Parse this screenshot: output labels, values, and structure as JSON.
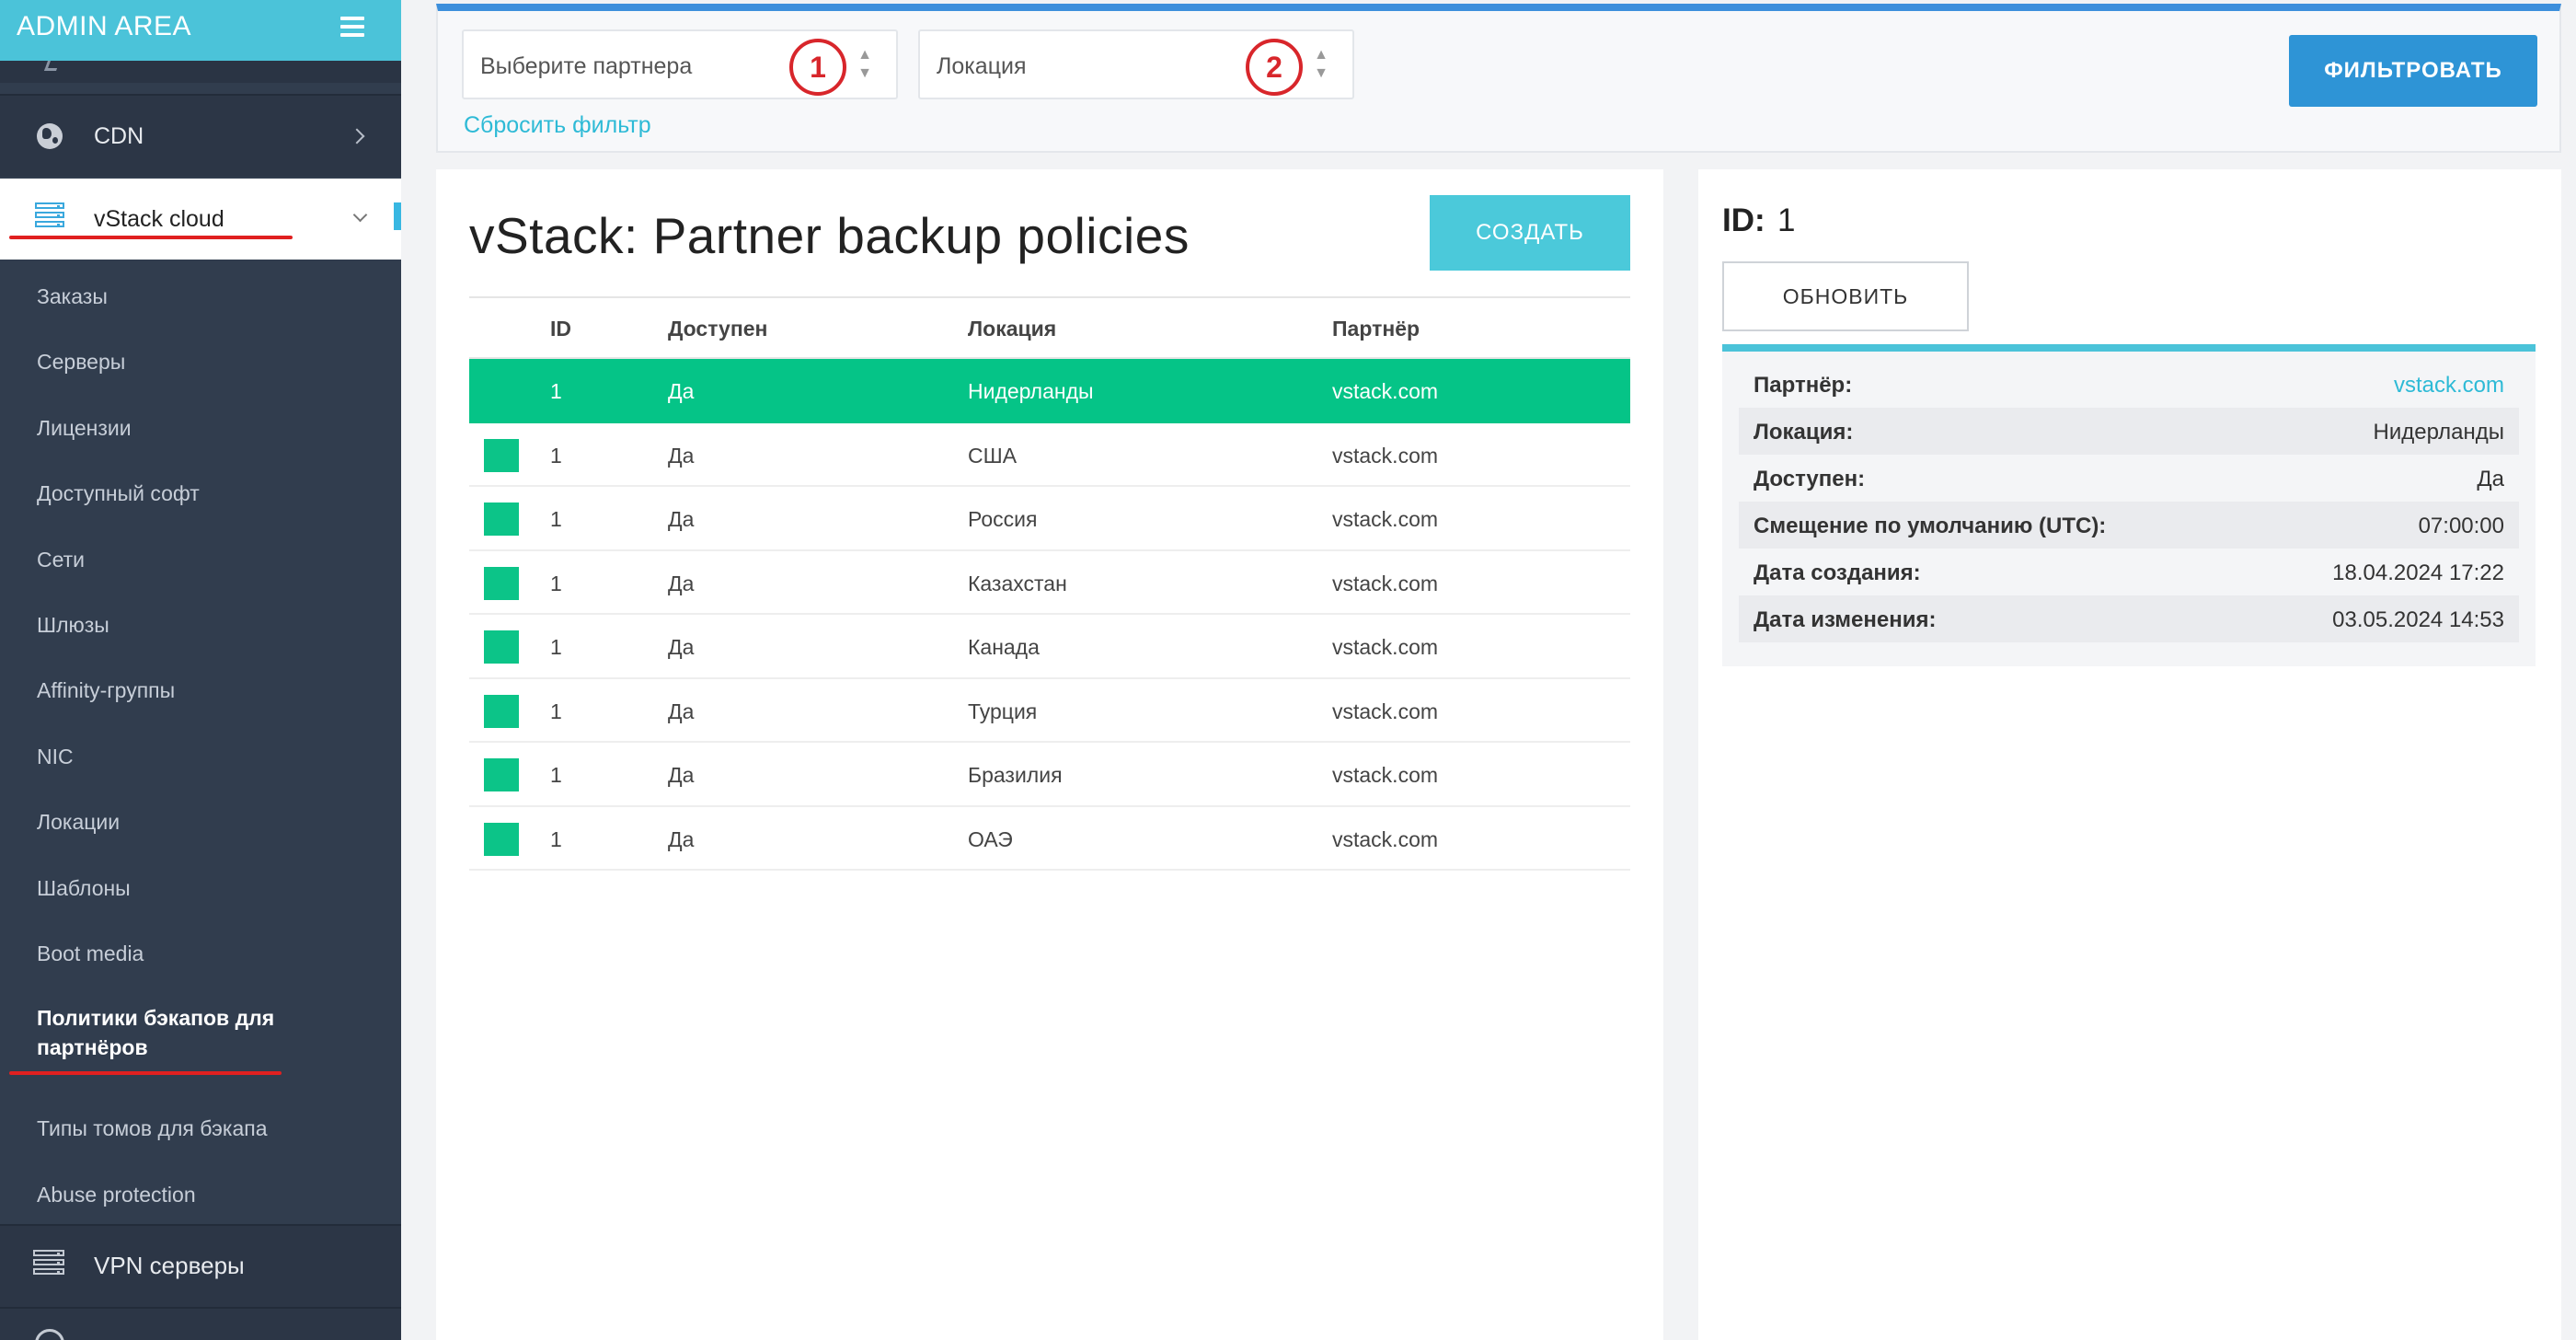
{
  "sidebar": {
    "title": "ADMIN AREA",
    "cdn_label": "CDN",
    "vstack_label": "vStack cloud",
    "menu_items": [
      "Заказы",
      "Серверы",
      "Лицензии",
      "Доступный софт",
      "Сети",
      "Шлюзы",
      "Affinity-группы",
      "NIC",
      "Локации",
      "Шаблоны",
      "Boot media"
    ],
    "active_item_line1": "Политики бэкапов для",
    "active_item_line2": "партнёров",
    "after_items": [
      "Типы томов для бэкапа",
      "Abuse protection"
    ],
    "vpn_label": "VPN серверы"
  },
  "filter": {
    "partner_placeholder": "Выберите партнера",
    "location_placeholder": "Локация",
    "badge1": "1",
    "badge2": "2",
    "reset_label": "Сбросить фильтр",
    "filter_button": "ФИЛЬТРОВАТЬ"
  },
  "list": {
    "title": "vStack: Partner backup policies",
    "create_button": "СОЗДАТЬ",
    "columns": [
      "ID",
      "Доступен",
      "Локация",
      "Партнёр"
    ],
    "rows": [
      {
        "id": "1",
        "available": "Да",
        "location": "Нидерланды",
        "partner": "vstack.com"
      },
      {
        "id": "1",
        "available": "Да",
        "location": "США",
        "partner": "vstack.com"
      },
      {
        "id": "1",
        "available": "Да",
        "location": "Россия",
        "partner": "vstack.com"
      },
      {
        "id": "1",
        "available": "Да",
        "location": "Казахстан",
        "partner": "vstack.com"
      },
      {
        "id": "1",
        "available": "Да",
        "location": "Канада",
        "partner": "vstack.com"
      },
      {
        "id": "1",
        "available": "Да",
        "location": "Турция",
        "partner": "vstack.com"
      },
      {
        "id": "1",
        "available": "Да",
        "location": "Бразилия",
        "partner": "vstack.com"
      },
      {
        "id": "1",
        "available": "Да",
        "location": "ОАЭ",
        "partner": "vstack.com"
      }
    ]
  },
  "detail": {
    "id_label": "ID:",
    "id_value": "1",
    "refresh_button": "ОБНОВИТЬ",
    "fields": [
      {
        "label": "Партнёр:",
        "value": "vstack.com"
      },
      {
        "label": "Локация:",
        "value": "Нидерланды"
      },
      {
        "label": "Доступен:",
        "value": "Да"
      },
      {
        "label": "Смещение по умолчанию (UTC):",
        "value": "07:00:00"
      },
      {
        "label": "Дата создания:",
        "value": "18.04.2024 17:22"
      },
      {
        "label": "Дата изменения:",
        "value": "03.05.2024 14:53"
      }
    ]
  },
  "colors": {
    "accent": "#4bc3d9",
    "selected_row": "#05c487",
    "filter_button": "#2e94d6",
    "annotation_red": "#d8262b"
  }
}
